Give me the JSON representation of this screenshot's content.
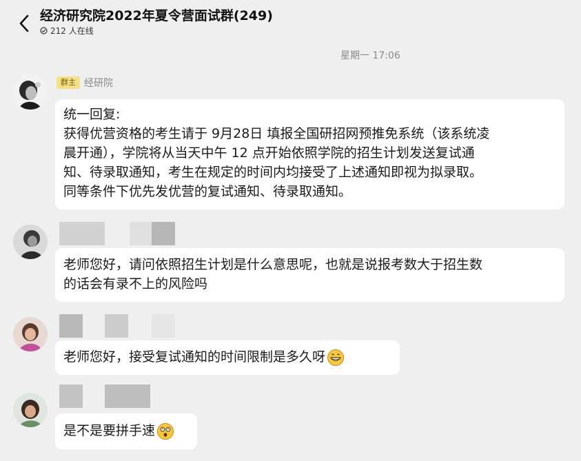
{
  "header": {
    "back_icon": "chevron-left-icon",
    "title": "经济研究院2022年夏令营面试群(249)",
    "online_icon": "online-status-icon",
    "online_text": "212 人在线"
  },
  "timestamp": "星期一 17:06",
  "messages": [
    {
      "badge": "群主",
      "sender": "经研院",
      "lines": [
        "统一回复:",
        "获得优营资格的考生请于 9月28日 填报全国研招网预推免系统（该系统凌",
        "晨开通），学院将从当天中午 12 点开始依照学院的招生计划发送复试通",
        "知、待录取通知，考生在规定的时间内均接受了上述通知即视为拟录取。",
        "同等条件下优先发优营的复试通知、待录取通知。"
      ]
    },
    {
      "lines": [
        "老师您好，请问依照招生计划是什么意思呢，也就是说报考数大于招生数",
        "的话会有录不上的风险吗"
      ]
    },
    {
      "lines": [
        "老师您好，接受复试通知的时间限制是多久呀"
      ],
      "emoji": "grinning-face-icon"
    },
    {
      "lines": [
        "是不是要拼手速"
      ],
      "emoji": "dizzy-face-icon"
    }
  ]
}
